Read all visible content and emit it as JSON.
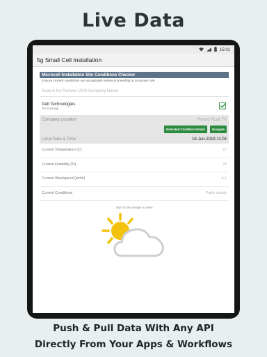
{
  "headline": "Live Data",
  "status_bar": {
    "time": "15:01"
  },
  "app": {
    "title": "5g Small Cell Installation"
  },
  "form": {
    "section_title": "Microcell Installation Site Conditions Checker",
    "instructions": "Ensure current conditions are acceptable before proceeding to customer site.",
    "search_placeholder": "Search for Fortune 1000 Company Name",
    "company": {
      "name": "Dell Technologies",
      "industry": "Technology",
      "checked": true
    },
    "location": {
      "label": "Company Location",
      "value": "Round Rock TX"
    },
    "buttons": {
      "extended": "Extended Condition Details",
      "navigate": "Navigate"
    },
    "datetime": {
      "label": "Local Date & Time",
      "value": "18-Jun-2019 11:04"
    },
    "conditions": [
      {
        "label": "Current Temperature (C)",
        "value": "27"
      },
      {
        "label": "Current Humidity (%)",
        "value": "74"
      },
      {
        "label": "Current Windspeed (km/h)",
        "value": "6.1"
      },
      {
        "label": "Current Conditions",
        "value": "Partly cloudy"
      }
    ],
    "tap_hint": "Tap on the image to view",
    "weather_icon": "partly-cloudy-icon"
  },
  "caption": {
    "line1": "Push & Pull Data With Any API",
    "line2": "Directly From Your Apps & Workflows"
  },
  "colors": {
    "background": "#e9efef",
    "section_header": "#5d7388",
    "button_green": "#2b8a3e",
    "sun": "#f2c20f"
  }
}
